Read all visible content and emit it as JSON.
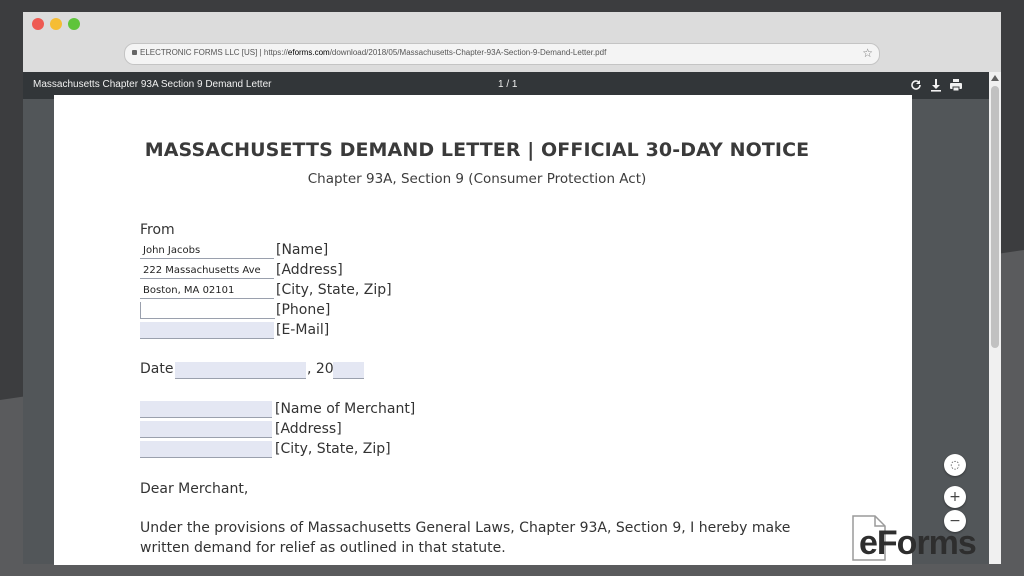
{
  "browser": {
    "url_prefix": "ELECTRONIC FORMS LLC [US] | https://",
    "url_host": "eforms.com",
    "url_path": "/download/2018/05/Massachusetts-Chapter-93A-Section-9-Demand-Letter.pdf",
    "star_icon": "star-icon"
  },
  "pdf_viewer": {
    "doc_title": "Massachusetts Chapter 93A Section 9 Demand Letter",
    "page_count": "1 / 1",
    "icons": [
      "rotate-icon",
      "download-icon",
      "print-icon"
    ]
  },
  "document": {
    "title": "MASSACHUSETTS DEMAND LETTER | OFFICIAL 30-DAY NOTICE",
    "subtitle": "Chapter 93A, Section 9 (Consumer Protection Act)",
    "from_label": "From",
    "sender_fields": [
      {
        "value": "John Jacobs",
        "label": "[Name]"
      },
      {
        "value": "222 Massachusetts Ave",
        "label": "[Address]"
      },
      {
        "value": "Boston, MA 02101",
        "label": "[City, State, Zip]"
      },
      {
        "value": "",
        "label": "[Phone]"
      },
      {
        "value": "",
        "label": "[E-Mail]"
      }
    ],
    "date_label": "Date",
    "date_value": "",
    "year_prefix": ", 20",
    "year_value": "",
    "merchant_fields": [
      {
        "value": "",
        "label": "[Name of Merchant]"
      },
      {
        "value": "",
        "label": "[Address]"
      },
      {
        "value": "",
        "label": "[City, State, Zip]"
      }
    ],
    "salutation": "Dear Merchant,",
    "body_line_1": "Under the provisions of Massachusetts General Laws, Chapter 93A, Section 9, I hereby make",
    "body_line_2": "written demand for relief as outlined in that statute."
  },
  "zoom": {
    "fit": "◌",
    "in": "+",
    "out": "−"
  },
  "branding": {
    "logo_text": "eForms"
  },
  "colors": {
    "field_fill": "#e4e7f3",
    "toolbar": "#323639",
    "viewer_bg": "#525659"
  }
}
